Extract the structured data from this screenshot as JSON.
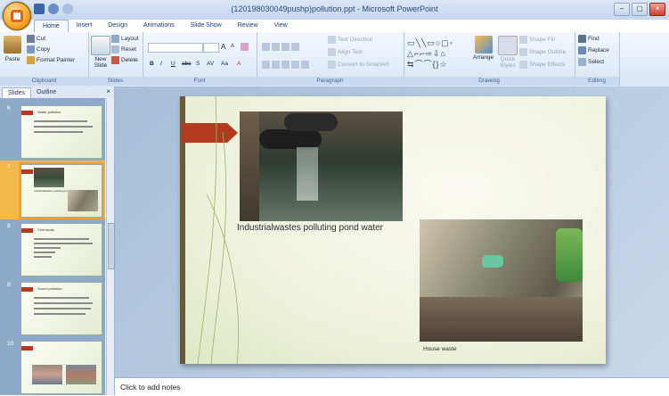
{
  "window": {
    "title": "(120198030049pushp)pollution.ppt - Microsoft PowerPoint",
    "minimize": "–",
    "maximize": "▢",
    "close": "×"
  },
  "tabs": [
    "Home",
    "Insert",
    "Design",
    "Animations",
    "Slide Show",
    "Review",
    "View"
  ],
  "ribbon": {
    "clipboard": {
      "label": "Clipboard",
      "paste": "Paste",
      "cut": "Cut",
      "copy": "Copy",
      "format_painter": "Format Painter"
    },
    "slides": {
      "label": "Slides",
      "new_slide_1": "New",
      "new_slide_2": "Slide",
      "layout": "Layout",
      "reset": "Reset",
      "delete": "Delete"
    },
    "font": {
      "label": "Font",
      "grow": "A",
      "shrink": "A",
      "bold": "B",
      "italic": "I",
      "underline": "U",
      "strike": "abc",
      "shadow": "S",
      "spacing": "AV",
      "case": "Aa",
      "color": "A"
    },
    "paragraph": {
      "label": "Paragraph",
      "text_direction": "Text Direction",
      "align_text": "Align Text",
      "convert": "Convert to SmartArt"
    },
    "drawing": {
      "label": "Drawing",
      "arrange": "Arrange",
      "quick_styles_1": "Quick",
      "quick_styles_2": "Styles",
      "shape_fill": "Shape Fill",
      "shape_outline": "Shape Outline",
      "shape_effects": "Shape Effects"
    },
    "editing": {
      "label": "Editing",
      "find": "Find",
      "replace": "Replace",
      "select": "Select"
    }
  },
  "pane": {
    "tab_slides": "Slides",
    "tab_outline": "Outline",
    "close": "×"
  },
  "thumbnails": [
    {
      "num": "6",
      "title": "Water pollution"
    },
    {
      "num": "7",
      "title": "Industrialwastes polluting pond water"
    },
    {
      "num": "8",
      "title": "Chemicals"
    },
    {
      "num": "9",
      "title": "Sound pollution"
    },
    {
      "num": "10",
      "title": ""
    }
  ],
  "slide": {
    "caption_main": "Industrialwastes polluting pond water",
    "caption_small": "House waste"
  },
  "notes": {
    "placeholder": "Click to add notes"
  },
  "colors": {
    "accent_arrow": "#b23a1e",
    "office_orange": "#f5a623"
  }
}
